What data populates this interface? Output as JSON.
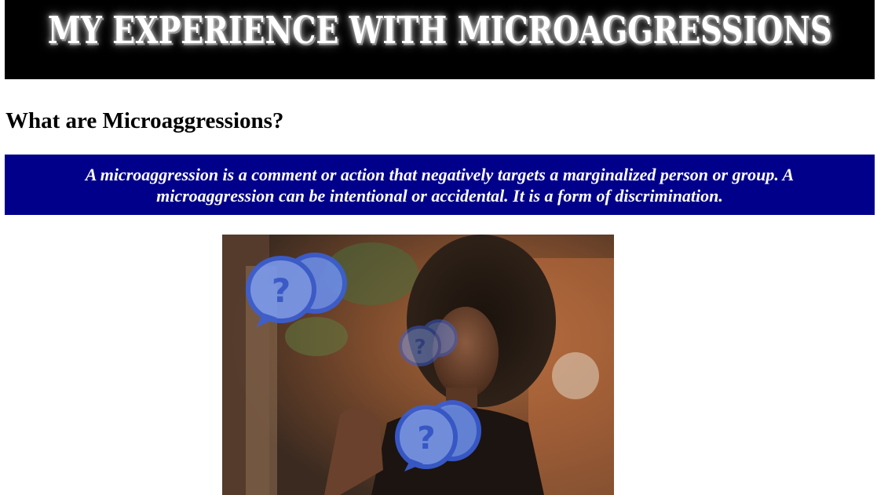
{
  "header": {
    "title": "My Experience with Microaggressions",
    "background_color": "#000000",
    "text_color": "#ffffff"
  },
  "section": {
    "heading": "What are Microaggressions?"
  },
  "definition": {
    "text": "A microaggression is a comment or action that negatively targets a marginalized person or group. A microaggression can be intentional or accidental. It is a form of discrimination.",
    "background_color": "#00008b",
    "text_color": "#ffffff"
  },
  "image": {
    "description_icon": "question-speech-bubble-icon",
    "accent_color": "#4169e1"
  }
}
